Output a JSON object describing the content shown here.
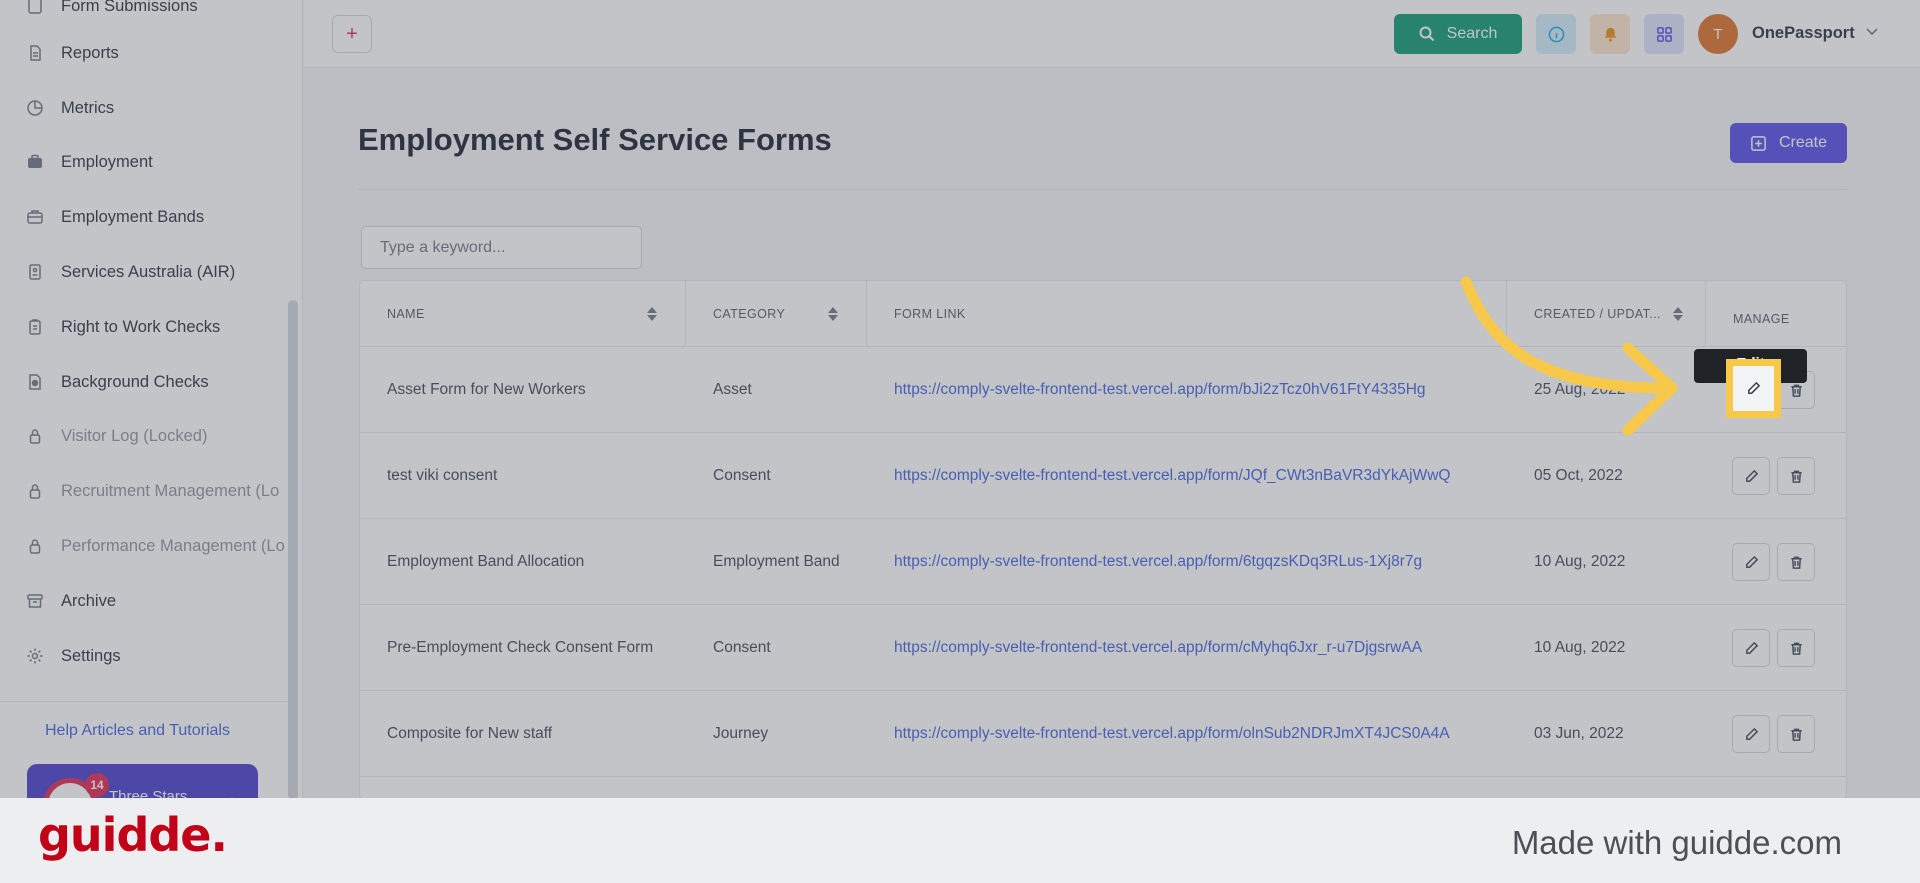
{
  "sidebar": {
    "partial_top_label": "Form Submissions",
    "items": [
      {
        "label": "Reports",
        "icon": "file-icon"
      },
      {
        "label": "Metrics",
        "icon": "pie-chart-icon"
      },
      {
        "label": "Employment",
        "icon": "briefcase-icon"
      },
      {
        "label": "Employment Bands",
        "icon": "briefcase-outline-icon"
      },
      {
        "label": "Services Australia (AIR)",
        "icon": "id-card-icon"
      },
      {
        "label": "Right to Work Checks",
        "icon": "clipboard-icon"
      },
      {
        "label": "Background Checks",
        "icon": "document-check-icon"
      },
      {
        "label": "Visitor Log (Locked)",
        "icon": "lock-icon"
      },
      {
        "label": "Recruitment Management (Lo",
        "icon": "lock-icon"
      },
      {
        "label": "Performance Management (Lo",
        "icon": "lock-icon"
      },
      {
        "label": "Archive",
        "icon": "archive-icon"
      },
      {
        "label": "Settings",
        "icon": "gear-icon"
      }
    ],
    "help_link": "Help Articles and Tutorials",
    "company": {
      "name": "Three Stars",
      "badge": "14"
    }
  },
  "topbar": {
    "add_symbol": "+",
    "search_label": "Search",
    "user_initial": "T",
    "user_name": "OnePassport"
  },
  "main": {
    "title": "Employment Self Service Forms",
    "create_label": "Create",
    "search_placeholder": "Type a keyword...",
    "columns": [
      "NAME",
      "CATEGORY",
      "FORM LINK",
      "CREATED / UPDAT...",
      "MANAGE"
    ],
    "rows": [
      {
        "name": "Asset Form for New Workers",
        "category": "Asset",
        "link": "https://comply-svelte-frontend-test.vercel.app/form/bJi2zTcz0hV61FtY4335Hg",
        "date": "25 Aug, 2022"
      },
      {
        "name": "test viki consent",
        "category": "Consent",
        "link": "https://comply-svelte-frontend-test.vercel.app/form/JQf_CWt3nBaVR3dYkAjWwQ",
        "date": "05 Oct, 2022"
      },
      {
        "name": "Employment Band Allocation",
        "category": "Employment Band",
        "link": "https://comply-svelte-frontend-test.vercel.app/form/6tgqzsKDq3RLus-1Xj8r7g",
        "date": "10 Aug, 2022"
      },
      {
        "name": "Pre-Employment Check Consent Form",
        "category": "Consent",
        "link": "https://comply-svelte-frontend-test.vercel.app/form/cMyhq6Jxr_r-u7DjgsrwAA",
        "date": "10 Aug, 2022"
      },
      {
        "name": "Composite for New staff",
        "category": "Journey",
        "link": "https://comply-svelte-frontend-test.vercel.app/form/olnSub2NDRJmXT4JCS0A4A",
        "date": "03 Jun, 2022"
      }
    ],
    "tooltip": "Edit"
  },
  "footer": {
    "brand": "guidde.",
    "made_with": "Made with guidde.com"
  },
  "colors": {
    "accent": "#4f46e5",
    "search_green": "#059669",
    "highlight": "#f7c84a",
    "brand_red": "#c20017"
  }
}
